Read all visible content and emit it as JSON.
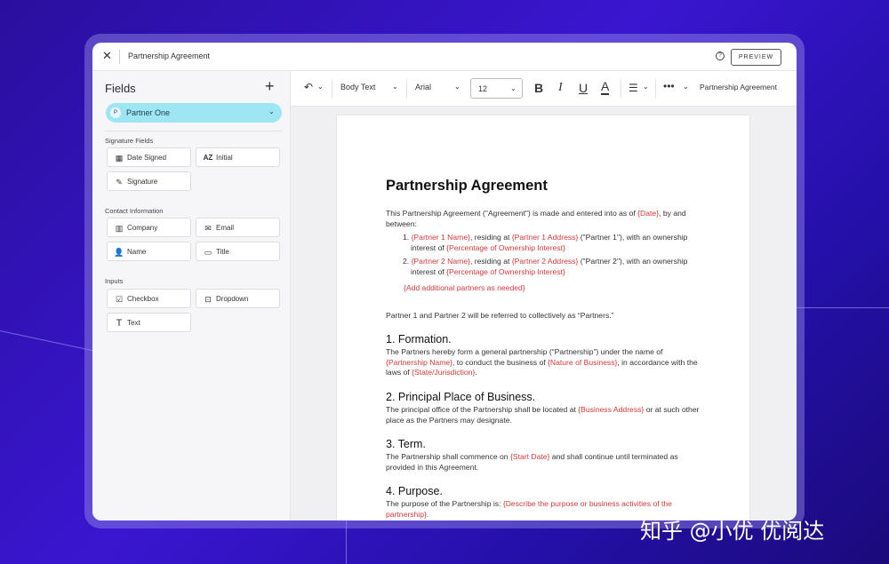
{
  "window": {
    "title": "Partnership Agreement",
    "preview_label": "PREVIEW"
  },
  "sidebar": {
    "title": "Fields",
    "partner": {
      "initial": "P",
      "label": "Partner One"
    },
    "sections": [
      {
        "label": "Signature Fields",
        "items": [
          {
            "label": "Date Signed",
            "icon": "calendar-icon"
          },
          {
            "label": "Initial",
            "icon": "initial-az-icon"
          },
          {
            "label": "Signature",
            "icon": "pen-icon"
          }
        ]
      },
      {
        "label": "Contact Information",
        "items": [
          {
            "label": "Company",
            "icon": "building-icon"
          },
          {
            "label": "Email",
            "icon": "mail-icon"
          },
          {
            "label": "Name",
            "icon": "person-icon"
          },
          {
            "label": "Title",
            "icon": "id-card-icon"
          }
        ]
      },
      {
        "label": "Inputs",
        "items": [
          {
            "label": "Checkbox",
            "icon": "checkbox-icon"
          },
          {
            "label": "Dropdown",
            "icon": "dropdown-icon"
          },
          {
            "label": "Text",
            "icon": "text-icon"
          }
        ]
      }
    ]
  },
  "toolbar": {
    "style": "Body Text",
    "font": "Arial",
    "size": "12",
    "doc_name": "Partnership Agreement"
  },
  "document": {
    "title": "Partnership Agreement",
    "intro_a": "This Partnership Agreement (\"Agreement\") is made and entered into as of ",
    "intro_date": "{Date}",
    "intro_b": ", by and between:",
    "partner1": {
      "num": "1. ",
      "name": "{Partner 1 Name}",
      "mid": ", residing at ",
      "address": "{Partner 1 Address}",
      "tail": " (\"Partner 1\"), with an ownership interest of ",
      "pct": "{Percentage of Ownership Interest}"
    },
    "partner2": {
      "num": "2. ",
      "name": "{Partner 2 Name}",
      "mid": ", residing at ",
      "address": "{Partner 2 Address}",
      "tail": " (\"Partner 2\"), with an ownership interest of ",
      "pct": "{Percentage of Ownership Interest}"
    },
    "add_partners": "{Add additional partners as needed}",
    "collective": "Partner 1 and Partner 2 will be referred to collectively as “Partners.”",
    "s1": {
      "heading": "1. Formation.",
      "a": "The Partners hereby form a general partnership (“Partnership”) under the name of ",
      "name": "{Partnership Name}",
      "b": ", to conduct the business of ",
      "nature": "{Nature of Business}",
      "c": ", in accordance with the laws of ",
      "state": "{State/Jurisdiction}",
      "d": "."
    },
    "s2": {
      "heading": "2. Principal Place of Business.",
      "a": "The principal office of the Partnership shall be located at ",
      "address": "{Business Address}",
      "b": " or at such other place as the Partners may designate."
    },
    "s3": {
      "heading": "3. Term.",
      "a": "The Partnership shall commence on ",
      "date": "{Start Date}",
      "b": " and shall continue until terminated as provided in this Agreement."
    },
    "s4": {
      "heading": "4. Purpose.",
      "a": "The purpose of the Partnership is: ",
      "purpose": "{Describe the purpose or business activities of the partnership}",
      "b": "."
    }
  },
  "watermark": "知乎 @小优 优阅达"
}
